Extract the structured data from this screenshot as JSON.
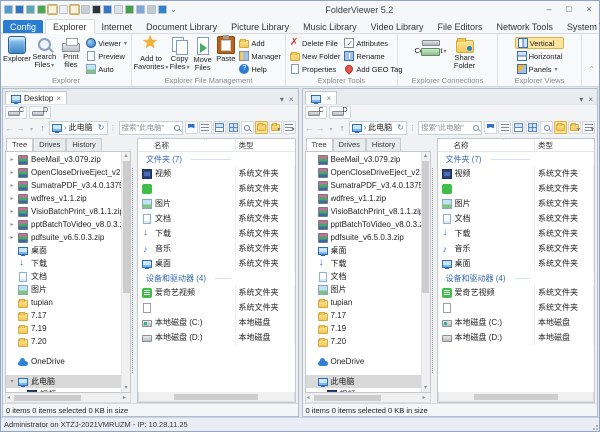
{
  "titlebar": {
    "title": "FolderViewer 5.2",
    "quick_access": [
      {
        "name": "qat-icon-1",
        "color": "#4e9bd4",
        "cls": ""
      },
      {
        "name": "qat-icon-2",
        "color": "#2f74bc",
        "cls": ""
      },
      {
        "name": "qat-icon-3",
        "color": "#58a8b4",
        "cls": ""
      },
      {
        "name": "qat-icon-4",
        "color": "#49a84e",
        "cls": ""
      },
      {
        "name": "qat-icon-5",
        "color": "#ffffff",
        "cls": "hl"
      },
      {
        "name": "qat-icon-6",
        "color": "#eef1f4",
        "cls": ""
      },
      {
        "name": "qat-icon-7",
        "color": "#ffffff",
        "cls": "hl"
      },
      {
        "name": "qat-icon-8",
        "color": "#c9cfd6",
        "cls": ""
      },
      {
        "name": "qat-icon-9",
        "color": "#2e3338",
        "cls": ""
      },
      {
        "name": "qat-icon-10",
        "color": "#3577c9",
        "cls": ""
      },
      {
        "name": "qat-icon-11",
        "color": "#dde2e7",
        "cls": ""
      },
      {
        "name": "qat-icon-12",
        "color": "#43a047",
        "cls": ""
      },
      {
        "name": "qat-icon-13",
        "color": "#7fa8d6",
        "cls": ""
      },
      {
        "name": "qat-icon-14",
        "color": "#c3c9d0",
        "cls": ""
      },
      {
        "name": "qat-icon-15",
        "color": "#2f82cf",
        "cls": ""
      }
    ]
  },
  "tab_bar": {
    "tabs": [
      {
        "label": "Config",
        "cls": "config"
      },
      {
        "label": "Explorer",
        "cls": "active"
      },
      {
        "label": "Internet",
        "cls": ""
      },
      {
        "label": "Document Library",
        "cls": ""
      },
      {
        "label": "Picture Library",
        "cls": ""
      },
      {
        "label": "Music Library",
        "cls": ""
      },
      {
        "label": "Video Library",
        "cls": ""
      },
      {
        "label": "File Editors",
        "cls": ""
      },
      {
        "label": "Network Tools",
        "cls": ""
      },
      {
        "label": "System Tools",
        "cls": ""
      }
    ]
  },
  "ribbon": {
    "groups": [
      {
        "label": "Explorer",
        "big": [
          {
            "label": "Explorer"
          },
          {
            "label": "Search Files"
          },
          {
            "label": "Print files"
          }
        ],
        "small": [
          {
            "label": "Viewer"
          },
          {
            "label": "Preview"
          },
          {
            "label": "Auto"
          }
        ]
      },
      {
        "label": "Explorer File Management",
        "big": [
          {
            "label": "Add to Favorites"
          },
          {
            "label": "Copy Files"
          },
          {
            "label": "Move Files"
          },
          {
            "label": "Paste"
          }
        ],
        "small": [
          {
            "label": "Add"
          },
          {
            "label": "Manager"
          },
          {
            "label": "Help"
          }
        ]
      },
      {
        "label": "Explorer Tools",
        "col1": [
          {
            "label": "Delete File"
          },
          {
            "label": "New Folder"
          },
          {
            "label": "Properties"
          }
        ],
        "col2": [
          {
            "label": "Attributes"
          },
          {
            "label": "Rename"
          },
          {
            "label": "Add GEO Tag"
          }
        ]
      },
      {
        "label": "Explorer Connections",
        "big": [
          {
            "label": "Connect"
          },
          {
            "label": "Share Folder"
          }
        ]
      },
      {
        "label": "Explorer Views",
        "small": [
          {
            "label": "Vertical"
          },
          {
            "label": "Horizontal"
          },
          {
            "label": "Panels"
          }
        ]
      }
    ]
  },
  "panel_left": {
    "tab_label": "Desktop"
  },
  "panel_right": {
    "tab_label": ""
  },
  "shared": {
    "drive_buttons": [
      "C",
      "D"
    ],
    "address": {
      "breadcrumb": "此电脑",
      "search_placeholder": "搜索\"此电脑\""
    },
    "tree_tabs": [
      "Tree",
      "Drives",
      "History"
    ],
    "tree_items": [
      {
        "cls": "",
        "exp_l": "▸",
        "exp_r": "",
        "icon": "fi-zip",
        "label": "BeeMail_v3.079.zip"
      },
      {
        "cls": "",
        "exp_l": "▸",
        "exp_r": "",
        "icon": "fi-zip",
        "label": "OpenCloseDriveEject_v2.66.zip"
      },
      {
        "cls": "",
        "exp_l": "▸",
        "exp_r": "",
        "icon": "fi-zip",
        "label": "SumatraPDF_v3.4.0.13758.zip"
      },
      {
        "cls": "",
        "exp_l": "▸",
        "exp_r": "",
        "icon": "fi-zip",
        "label": "wdfres_v1.1.zip"
      },
      {
        "cls": "",
        "exp_l": "▸",
        "exp_r": "",
        "icon": "fi-zip",
        "label": "VisioBatchPrint_v8.1.1.zip"
      },
      {
        "cls": "",
        "exp_l": "▸",
        "exp_r": "",
        "icon": "fi-zip",
        "label": "pptBatchToVideo_v8.0.3.zip"
      },
      {
        "cls": "",
        "exp_l": "▸",
        "exp_r": "",
        "icon": "fi-zip",
        "label": "pdfsuite_v6.5.0.3.zip"
      },
      {
        "cls": "",
        "exp_l": "",
        "exp_r": "",
        "icon": "fi-desktop",
        "label": "桌面"
      },
      {
        "cls": "",
        "exp_l": "",
        "exp_r": "",
        "icon": "fi-download",
        "label": "下载"
      },
      {
        "cls": "",
        "exp_l": "",
        "exp_r": "",
        "icon": "fi-doc",
        "label": "文档"
      },
      {
        "cls": "",
        "exp_l": "",
        "exp_r": "",
        "icon": "fi-pic",
        "label": "图片"
      },
      {
        "cls": "",
        "exp_l": "",
        "exp_r": "",
        "icon": "fi-folder",
        "label": "tupian"
      },
      {
        "cls": "",
        "exp_l": "",
        "exp_r": "",
        "icon": "fi-folder",
        "label": "7.17"
      },
      {
        "cls": "",
        "exp_l": "",
        "exp_r": "",
        "icon": "fi-folder",
        "label": "7.19"
      },
      {
        "cls": "",
        "exp_l": "",
        "exp_r": "",
        "icon": "fi-folder",
        "label": "7.20"
      },
      {
        "cls": "gap",
        "exp_l": "",
        "exp_r": "",
        "icon": "",
        "label": ""
      },
      {
        "cls": "",
        "exp_l": "",
        "exp_r": "",
        "icon": "fi-cloud",
        "label": "OneDrive"
      },
      {
        "cls": "gap",
        "exp_l": "",
        "exp_r": "",
        "icon": "",
        "label": ""
      },
      {
        "cls": "selected",
        "exp_l": "▾",
        "exp_r": "",
        "icon": "fi-pc",
        "label": "此电脑"
      },
      {
        "cls": "ind1",
        "exp_l": "▸",
        "exp_r": "",
        "icon": "fi-video",
        "label": "视频"
      }
    ],
    "list_columns": [
      "名称",
      "类型"
    ],
    "list_rows": [
      {
        "cls": "group",
        "icon": "",
        "name": "文件夹 (7)",
        "type": ""
      },
      {
        "cls": "",
        "icon": "fi-video",
        "name": "视频",
        "type": "系统文件夹"
      },
      {
        "cls": "",
        "icon": "fi-wps",
        "name": "",
        "type": "系统文件夹"
      },
      {
        "cls": "",
        "icon": "fi-pic",
        "name": "图片",
        "type": "系统文件夹"
      },
      {
        "cls": "",
        "icon": "fi-doc",
        "name": "文档",
        "type": "系统文件夹"
      },
      {
        "cls": "",
        "icon": "fi-download",
        "name": "下载",
        "type": "系统文件夹"
      },
      {
        "cls": "",
        "icon": "fi-music",
        "name": "音乐",
        "type": "系统文件夹"
      },
      {
        "cls": "",
        "icon": "fi-desktop",
        "name": "桌面",
        "type": "系统文件夹"
      },
      {
        "cls": "group",
        "icon": "",
        "name": "设备和驱动器 (4)",
        "type": ""
      },
      {
        "cls": "",
        "icon": "fi-iqiyi",
        "name": "爱奇艺视频",
        "type": "系统文件夹"
      },
      {
        "cls": "",
        "icon": "fi-blank",
        "name": "",
        "type": "系统文件夹"
      },
      {
        "cls": "",
        "icon": "fi-diskc",
        "name": "本地磁盘 (C:)",
        "type": "本地磁盘"
      },
      {
        "cls": "",
        "icon": "fi-diskd",
        "name": "本地磁盘 (D:)",
        "type": "本地磁盘"
      }
    ],
    "status": "0 items  0 items selected 0 KB in size"
  },
  "app_status": "Administrator on XTZJ-2021VMRUZM - IP: 10.28.11.25"
}
